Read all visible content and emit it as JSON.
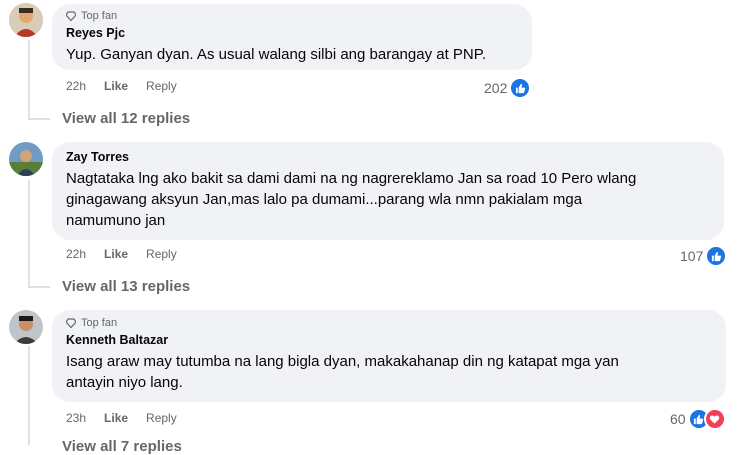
{
  "comments": [
    {
      "author": "Reyes Pjc",
      "badge": "Top fan",
      "text": "Yup. Ganyan dyan. As usual walang silbi ang barangay at PNP.",
      "time": "22h",
      "like_label": "Like",
      "reply_label": "Reply",
      "reaction_count": "202",
      "reactions": [
        "like-icon"
      ],
      "view_replies": "View all 12 replies"
    },
    {
      "author": "Zay Torres",
      "text_lines": [
        "Nagtataka lng ako bakit sa dami dami na ng nagrereklamo Jan sa road 10 Pero wlang",
        "ginagawang aksyun Jan,mas lalo pa dumami...parang wla nmn pakialam mga",
        "namumuno jan"
      ],
      "time": "22h",
      "like_label": "Like",
      "reply_label": "Reply",
      "reaction_count": "107",
      "reactions": [
        "like-icon"
      ],
      "view_replies": "View all 13 replies"
    },
    {
      "author": "Kenneth Baltazar",
      "badge": "Top fan",
      "text_lines": [
        "Isang araw may tutumba na lang bigla dyan, makakahanap din ng katapat mga yan",
        "antayin niyo lang."
      ],
      "time": "23h",
      "like_label": "Like",
      "reply_label": "Reply",
      "reaction_count": "60",
      "reactions": [
        "like-icon",
        "love-icon"
      ],
      "view_replies": "View all 7 replies"
    }
  ],
  "colors": {
    "bubble": "#f0f2f5",
    "like_blue": "#1b74e4",
    "love_red": "#f33e58",
    "muted": "#65676b"
  }
}
